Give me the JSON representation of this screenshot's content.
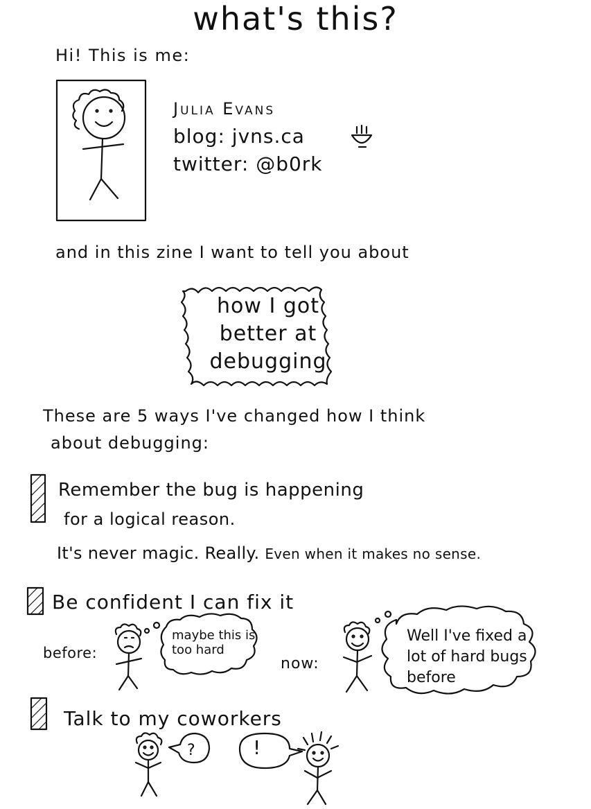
{
  "title": "what's this?",
  "greeting": "Hi! This is me:",
  "author": {
    "name": "Julia Evans",
    "blog": "blog: jvns.ca",
    "twitter": "twitter: @b0rk"
  },
  "intro": "and in this zine I want to tell you about",
  "cloud": {
    "line1": "how I got",
    "line2": "better at",
    "line3": "debugging"
  },
  "ways": {
    "line1": "These are 5 ways I've changed how I think",
    "line2": "about debugging:"
  },
  "items": [
    {
      "line1": "Remember the bug is happening",
      "line2": "for a logical reason.",
      "note_main": "It's never magic. Really.",
      "note_small": "Even when it makes no sense."
    },
    {
      "title": "Be confident I can fix it",
      "before_label": "before:",
      "before_thought": "maybe this is too hard",
      "now_label": "now:",
      "now_thought": "Well I've fixed a lot of hard bugs before"
    },
    {
      "title": "Talk to my coworkers",
      "question": "?",
      "exclaim": "!"
    }
  ],
  "icons": {
    "portrait": "stick-figure-portrait-icon",
    "bowl": "ramen-bowl-icon",
    "checkbox": "hatched-checkbox-icon"
  }
}
